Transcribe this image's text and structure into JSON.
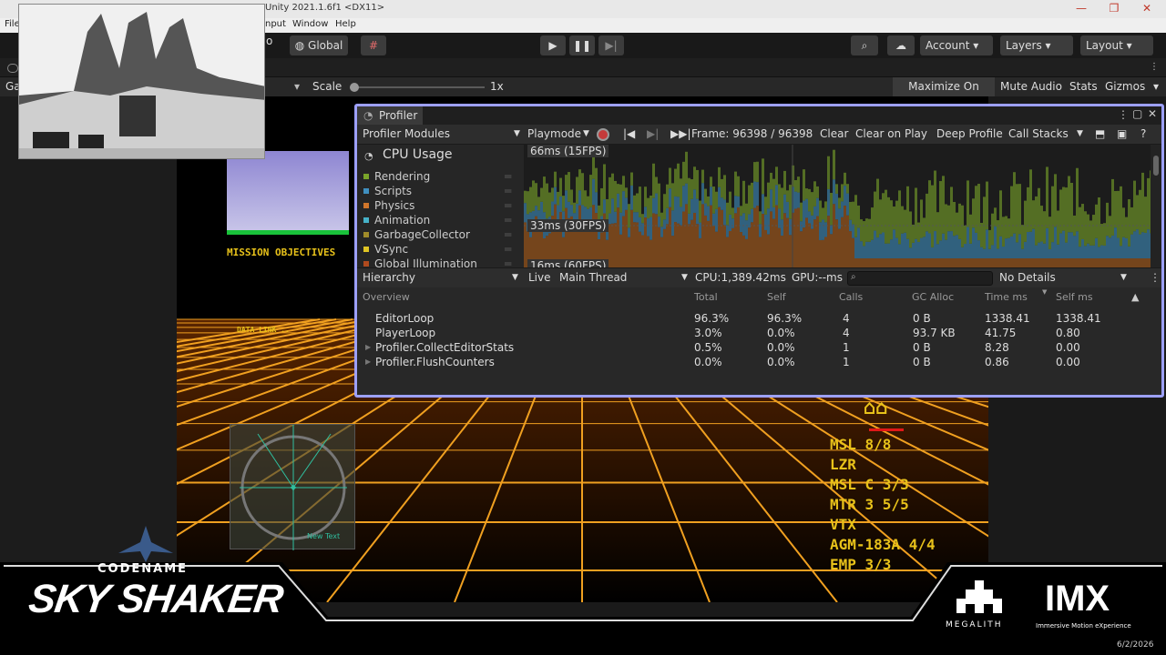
{
  "window": {
    "title": "Unity 2021.1.6f1 <DX11>",
    "minimize": "—",
    "maximize": "❐",
    "close": "✕"
  },
  "menu": {
    "file": "File",
    "input": "nput",
    "window": "Window",
    "help": "Help"
  },
  "toolbar": {
    "global": "Global",
    "account": "Account",
    "layers": "Layers",
    "layout": "Layout",
    "letter_o": "o"
  },
  "gamebar": {
    "tab": "Ga",
    "scale_label": "Scale",
    "scale_value": "1x",
    "scale_fraction": 0,
    "maximize_on_play": "Maximize On Play",
    "mute_audio": "Mute Audio",
    "stats": "Stats",
    "gizmos": "Gizmos"
  },
  "game": {
    "objectives_title": "MISSION OBJECTIVES",
    "data_link": "DATA LINK ..",
    "small_tag": "ID",
    "radar_text": "New Text",
    "weapons": [
      "MSL 8/8",
      "LZR",
      "MSL C 3/3",
      "MTR 3 5/5",
      "VTX",
      "AGM-183A 4/4",
      "EMP 3/3"
    ]
  },
  "profiler": {
    "tab": "Profiler",
    "modules_label": "Profiler Modules",
    "playmode": "Playmode",
    "frame": "Frame: 96398 / 96398",
    "clear": "Clear",
    "clear_on_play": "Clear on Play",
    "deep_profile": "Deep Profile",
    "call_stacks": "Call Stacks",
    "cpu_usage": "CPU Usage",
    "modules": [
      {
        "label": "Rendering",
        "color": "#7aa52a"
      },
      {
        "label": "Scripts",
        "color": "#3f8fbf"
      },
      {
        "label": "Physics",
        "color": "#d0762b"
      },
      {
        "label": "Animation",
        "color": "#46b2c8"
      },
      {
        "label": "GarbageCollector",
        "color": "#a08b2a"
      },
      {
        "label": "VSync",
        "color": "#e0c524"
      },
      {
        "label": "Global Illumination",
        "color": "#b04a1e"
      }
    ],
    "graph_labels": {
      "fps15": "66ms (15FPS)",
      "fps30": "33ms (30FPS)",
      "fps60": "16ms (60FPS)"
    },
    "hierarchy": "Hierarchy",
    "live": "Live",
    "main_thread": "Main Thread",
    "cpu_time": "CPU:1,389.42ms",
    "gpu_time": "GPU:--ms",
    "no_details": "No Details",
    "columns": [
      "Overview",
      "Total",
      "Self",
      "Calls",
      "GC Alloc",
      "Time ms",
      "Self ms"
    ],
    "rows": [
      {
        "name": "EditorLoop",
        "total": "96.3%",
        "self": "96.3%",
        "calls": "4",
        "gc": "0 B",
        "time": "1338.41",
        "selfms": "1338.41"
      },
      {
        "name": "PlayerLoop",
        "total": "3.0%",
        "self": "0.0%",
        "calls": "4",
        "gc": "93.7 KB",
        "time": "41.75",
        "selfms": "0.80"
      },
      {
        "name": "Profiler.CollectEditorStats",
        "total": "0.5%",
        "self": "0.0%",
        "calls": "1",
        "gc": "0 B",
        "time": "8.28",
        "selfms": "0.00"
      },
      {
        "name": "Profiler.FlushCounters",
        "total": "0.0%",
        "self": "0.0%",
        "calls": "1",
        "gc": "0 B",
        "time": "0.86",
        "selfms": "0.00"
      }
    ]
  },
  "branding": {
    "codename": "CODENAME",
    "title": "SKY SHAKER",
    "megalith": "MEGALITH",
    "imx": "IMX",
    "imx_tagline": "Immersive Motion eXperience",
    "date": "6/2/2026"
  }
}
